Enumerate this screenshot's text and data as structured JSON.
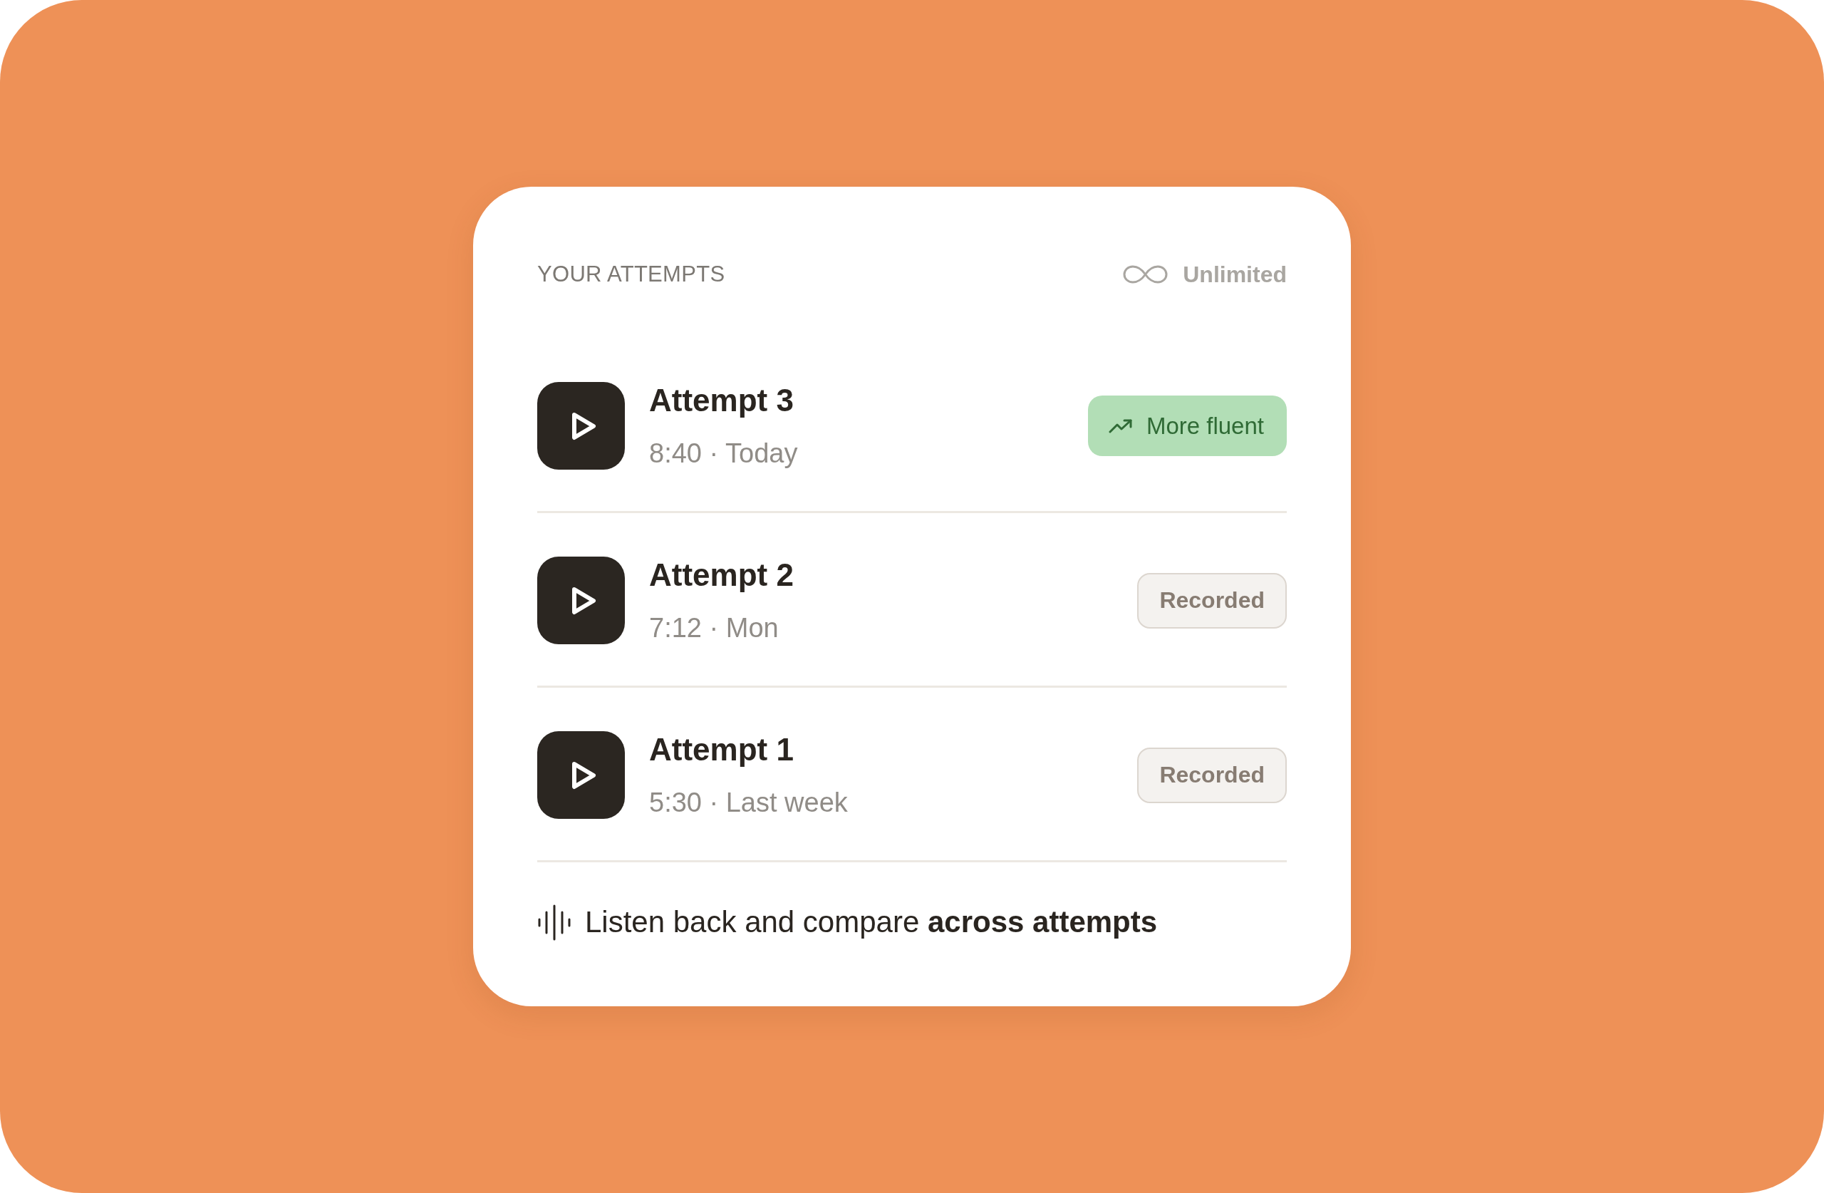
{
  "header": {
    "title": "YOUR ATTEMPTS",
    "limit": "Unlimited"
  },
  "attempts": [
    {
      "title": "Attempt 3",
      "meta": "8:40 · Today",
      "badge": {
        "label": "More fluent",
        "kind": "improved"
      }
    },
    {
      "title": "Attempt 2",
      "meta": "7:12 · Mon",
      "badge": {
        "label": "Recorded",
        "kind": "recorded"
      }
    },
    {
      "title": "Attempt 1",
      "meta": "5:30 · Last week",
      "badge": {
        "label": "Recorded",
        "kind": "recorded"
      }
    }
  ],
  "footer": {
    "text": "Listen back and compare **across attempts**"
  }
}
